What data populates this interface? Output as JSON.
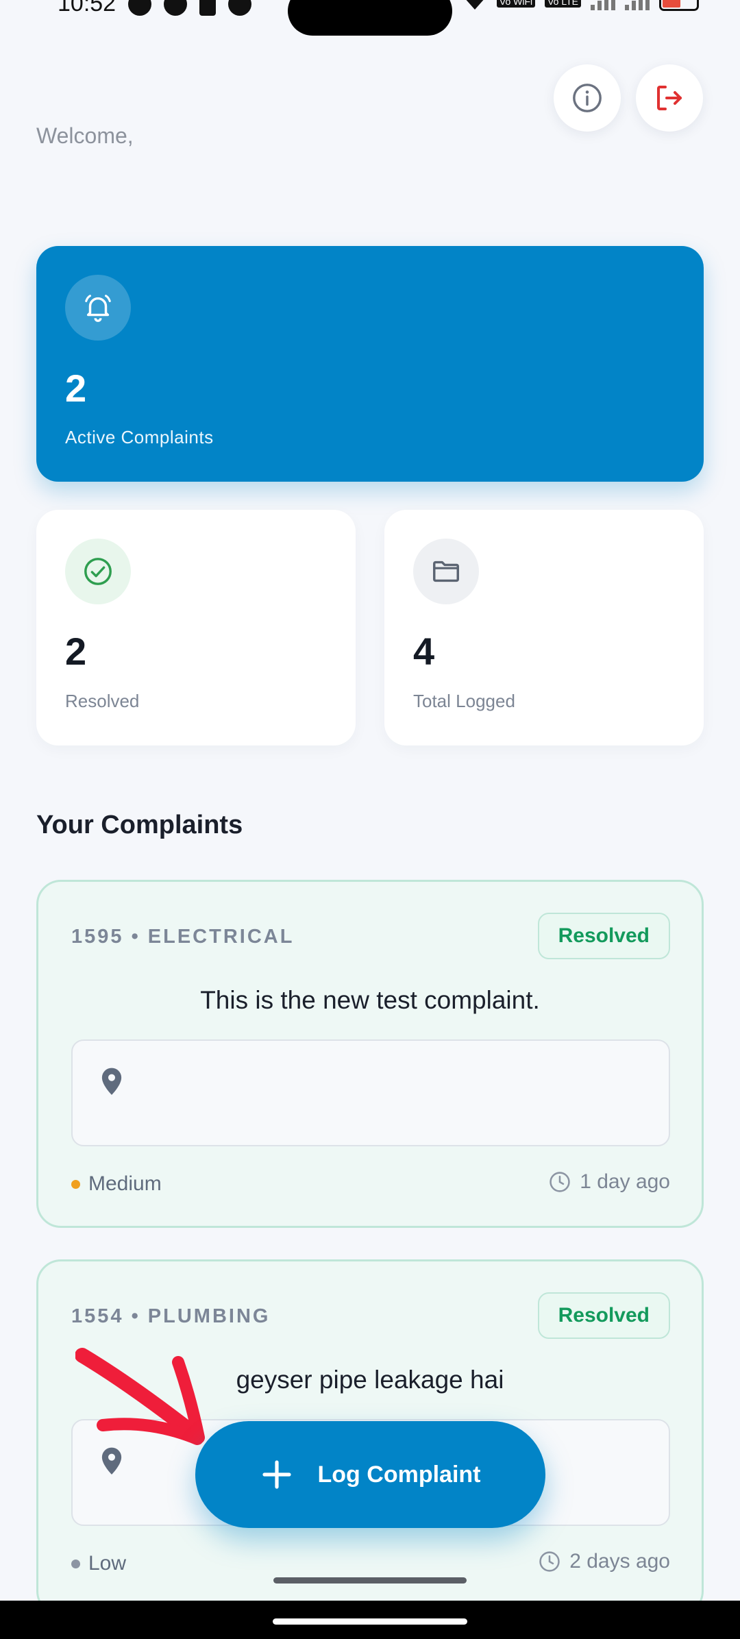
{
  "status_bar": {
    "time": "10:52",
    "battery": "17",
    "volte_1": "Vo WiFi",
    "volte_2": "Vo LTE"
  },
  "header": {
    "welcome_text": "Welcome,"
  },
  "stats": {
    "active": {
      "count": "2",
      "label": "Active Complaints"
    },
    "resolved": {
      "count": "2",
      "label": "Resolved"
    },
    "total": {
      "count": "4",
      "label": "Total Logged"
    }
  },
  "section_title": "Your Complaints",
  "complaints": [
    {
      "meta": "1595 • ELECTRICAL",
      "status": "Resolved",
      "title": "This is the new test complaint.",
      "priority": "Medium",
      "priority_color": "#f0a020",
      "time": "1 day ago"
    },
    {
      "meta": "1554 • PLUMBING",
      "status": "Resolved",
      "title": "geyser pipe leakage hai",
      "priority": "Low",
      "priority_color": "#8c95a3",
      "time": "2 days ago"
    }
  ],
  "fab": {
    "label": "Log Complaint"
  },
  "colors": {
    "primary": "#0284c7",
    "success": "#139a5c",
    "logout": "#e03131"
  }
}
